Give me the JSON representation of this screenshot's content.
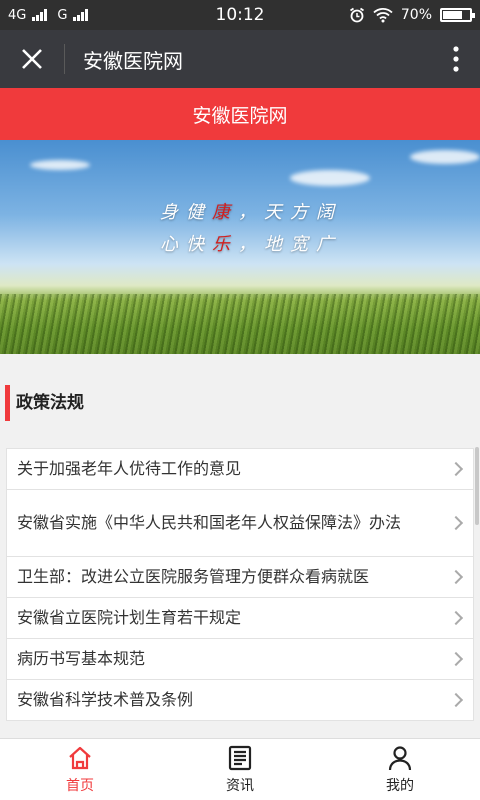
{
  "status_bar": {
    "network1": "4G",
    "network2": "G",
    "time": "10:12",
    "battery": "70%"
  },
  "nav": {
    "title": "安徽医院网"
  },
  "header": {
    "title": "安徽医院网"
  },
  "banner": {
    "line1_a": "身健",
    "line1_red": "康",
    "line1_b": "，天方阔",
    "line2_a": "心快",
    "line2_red": "乐",
    "line2_b": "，地宽广"
  },
  "section": {
    "title": "政策法规"
  },
  "list": [
    "关于加强老年人优待工作的意见",
    "安徽省实施《中华人民共和国老年人权益保障法》办法",
    "卫生部：改进公立医院服务管理方便群众看病就医",
    "安徽省立医院计划生育若干规定",
    "病历书写基本规范",
    "安徽省科学技术普及条例"
  ],
  "tabs": {
    "home": "首页",
    "news": "资讯",
    "mine": "我的"
  },
  "colors": {
    "accent": "#f03a3c",
    "nav_bg": "#393a3f"
  }
}
